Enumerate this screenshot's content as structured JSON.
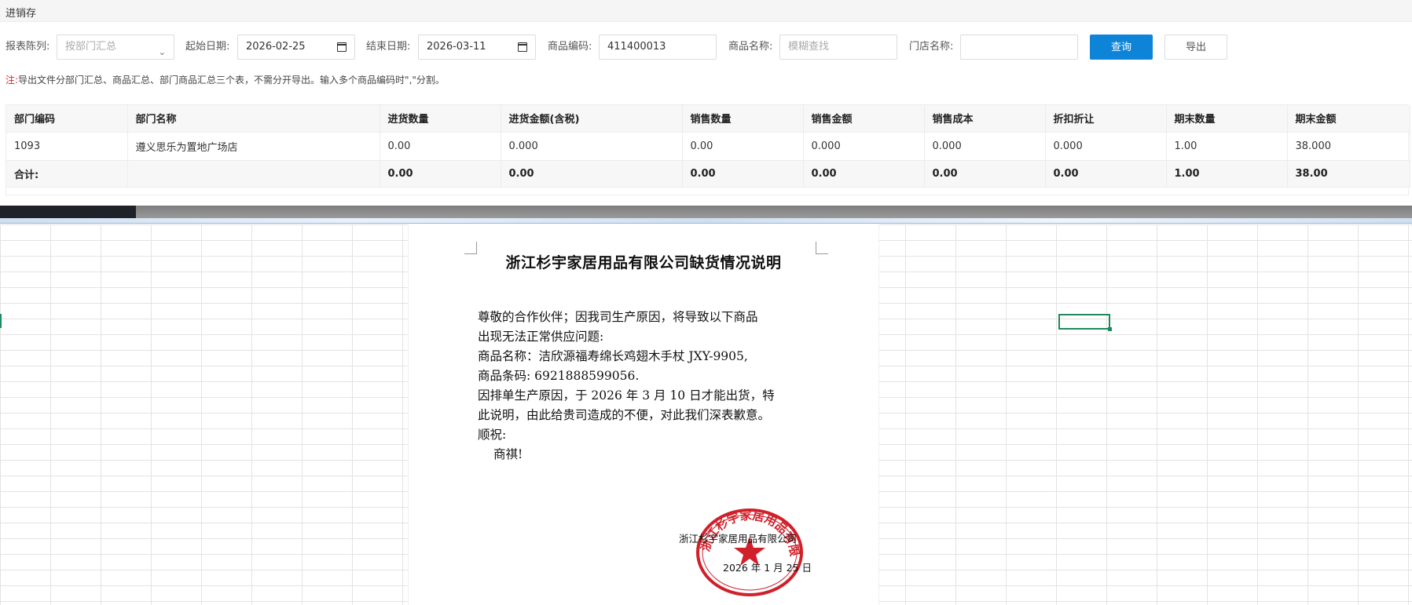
{
  "window": {
    "title": "进销存"
  },
  "filters": {
    "report_column_label": "报表陈列:",
    "report_column_value": "按部门汇总",
    "start_date_label": "起始日期:",
    "start_date_value": "2026-02-25",
    "end_date_label": "结束日期:",
    "end_date_value": "2026-03-11",
    "product_code_label": "商品编码:",
    "product_code_value": "411400013",
    "product_name_label": "商品名称:",
    "product_name_placeholder": "模糊查找",
    "store_name_label": "门店名称:",
    "store_name_value": "",
    "query_button": "查询",
    "export_button": "导出"
  },
  "note": {
    "prefix": "注:",
    "text": "导出文件分部门汇总、商品汇总、部门商品汇总三个表，不需分开导出。输入多个商品编码时\",\"分割。"
  },
  "table": {
    "headers": [
      "部门编码",
      "部门名称",
      "进货数量",
      "进货金额(含税)",
      "销售数量",
      "销售金额",
      "销售成本",
      "折扣折让",
      "期末数量",
      "期末金额"
    ],
    "rows": [
      [
        "1093",
        "遵义思乐为置地广场店",
        "0.00",
        "0.000",
        "0.00",
        "0.000",
        "0.000",
        "0.000",
        "1.00",
        "38.000"
      ]
    ],
    "total": [
      "合计:",
      "",
      "0.00",
      "0.00",
      "0.00",
      "0.00",
      "0.00",
      "0.00",
      "1.00",
      "38.00"
    ]
  },
  "document": {
    "title": "浙江杉宇家居用品有限公司缺货情况说明",
    "lines": [
      "尊敬的合作伙伴；因我司生产原因，将导致以下商品",
      "出现无法正常供应问题:",
      "商品名称：洁欣源福寿绵长鸡翅木手杖 JXY-9905,",
      "商品条码:    6921888599056.",
      "因排单生产原因，于 2026 年 3 月 10 日才能出货，特",
      "此说明，由此给贵司造成的不便，对此我们深表歉意。",
      "顺祝:",
      "商祺!"
    ],
    "company": "浙江杉宇家居用品有限公司",
    "date": "2026 年 1 月 25 日",
    "seal_text": "浙江杉宇家居用品有限公司"
  },
  "colors": {
    "primary_button": "#0e84d9",
    "note_prefix": "#e02020",
    "seal": "#d0202a",
    "selected_cell": "#1e8a5c"
  }
}
